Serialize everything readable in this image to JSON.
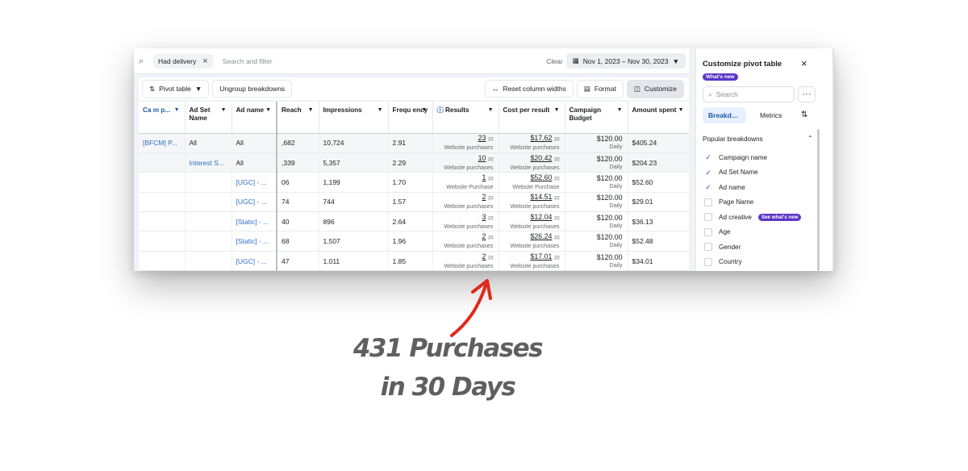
{
  "topbar": {
    "filter_chip": "Had delivery",
    "filter_placeholder": "Search and filter",
    "clear_label": "Clear",
    "date_range": "Nov 1, 2023 – Nov 30, 2023"
  },
  "toolbar": {
    "pivot_label": "Pivot table",
    "ungroup_label": "Ungroup breakdowns",
    "reset_label": "Reset column widths",
    "format_label": "Format",
    "customize_label": "Customize"
  },
  "table": {
    "headers": [
      "Ca m p...",
      "Ad Set Name",
      "Ad name",
      "Reach",
      "Impressions",
      "Frequ ency",
      "Results",
      "Cost per result",
      "Campaign Budget",
      "Amount spent"
    ],
    "rows": [
      {
        "campaign": "[BFCM] P...",
        "adset": "All",
        "ad": "All",
        "reach": ",682",
        "impressions": "10,724",
        "frequency": "2.91",
        "results": "23",
        "results_sub": "Website purchases",
        "cpr": "$17.62",
        "cpr_sub": "Website purchases",
        "budget": "$120.00",
        "budget_sub": "Daily",
        "spent": "$405.24"
      },
      {
        "campaign": "",
        "adset": "Interest S...",
        "ad": "All",
        "reach": ",339",
        "impressions": "5,357",
        "frequency": "2.29",
        "results": "10",
        "results_sub": "Website purchases",
        "cpr": "$20.42",
        "cpr_sub": "Website purchases",
        "budget": "$120.00",
        "budget_sub": "Daily",
        "spent": "$204.23"
      },
      {
        "campaign": "",
        "adset": "",
        "ad": "[UGC] - ...",
        "reach": "06",
        "impressions": "1,199",
        "frequency": "1.70",
        "results": "1",
        "results_sub": "Website Purchase",
        "cpr": "$52.60",
        "cpr_sub": "Website Purchase",
        "budget": "$120.00",
        "budget_sub": "Daily",
        "spent": "$52.60"
      },
      {
        "campaign": "",
        "adset": "",
        "ad": "[UGC] - ...",
        "reach": "74",
        "impressions": "744",
        "frequency": "1.57",
        "results": "2",
        "results_sub": "Website purchases",
        "cpr": "$14.51",
        "cpr_sub": "Website purchases",
        "budget": "$120.00",
        "budget_sub": "Daily",
        "spent": "$29.01"
      },
      {
        "campaign": "",
        "adset": "",
        "ad": "[Static] - ...",
        "reach": "40",
        "impressions": "896",
        "frequency": "2.64",
        "results": "3",
        "results_sub": "Website purchases",
        "cpr": "$12.04",
        "cpr_sub": "Website purchases",
        "budget": "$120.00",
        "budget_sub": "Daily",
        "spent": "$36.13"
      },
      {
        "campaign": "",
        "adset": "",
        "ad": "[Static] - ...",
        "reach": "68",
        "impressions": "1,507",
        "frequency": "1.96",
        "results": "2",
        "results_sub": "Website purchases",
        "cpr": "$26.24",
        "cpr_sub": "Website purchases",
        "budget": "$120.00",
        "budget_sub": "Daily",
        "spent": "$52.48"
      },
      {
        "campaign": "",
        "adset": "",
        "ad": "[UGC] - ...",
        "reach": "47",
        "impressions": "1,011",
        "frequency": "1.85",
        "results": "2",
        "results_sub": "Website purchases",
        "cpr": "$17.01",
        "cpr_sub": "Website purchases",
        "budget": "$120.00",
        "budget_sub": "Daily",
        "spent": "$34.01"
      }
    ],
    "ref_mark": "[2]"
  },
  "panel": {
    "title": "Customize pivot table",
    "whats_new": "What's new",
    "search_placeholder": "Search",
    "more_label": "···",
    "tab_breakdowns": "Breakdowns",
    "tab_metrics": "Metrics",
    "section_title": "Popular breakdowns",
    "options": [
      {
        "label": "Campaign name",
        "checked": true
      },
      {
        "label": "Ad Set Name",
        "checked": true
      },
      {
        "label": "Ad name",
        "checked": true
      },
      {
        "label": "Page Name",
        "checked": false
      },
      {
        "label": "Ad creative",
        "checked": false,
        "badge": "See what's new"
      },
      {
        "label": "Age",
        "checked": false
      },
      {
        "label": "Gender",
        "checked": false
      },
      {
        "label": "Country",
        "checked": false
      }
    ]
  },
  "annotation": {
    "line1": "431 Purchases",
    "line2": "in 30 Days",
    "arrow_color": "#e0291a"
  }
}
